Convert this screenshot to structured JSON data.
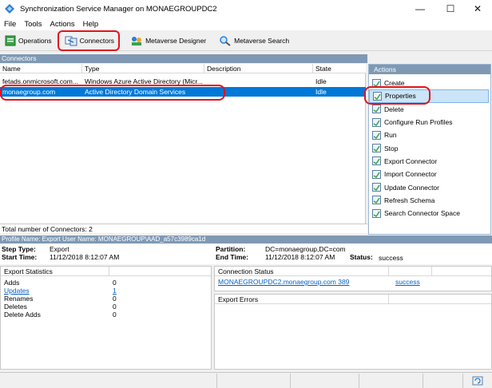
{
  "window": {
    "title": "Synchronization Service Manager on MONAEGROUPDC2",
    "minimize": "—",
    "maximize": "☐",
    "close": "✕"
  },
  "menu": [
    "File",
    "Tools",
    "Actions",
    "Help"
  ],
  "toolbar": {
    "operations": "Operations",
    "connectors": "Connectors",
    "metaverse_designer": "Metaverse Designer",
    "metaverse_search": "Metaverse Search"
  },
  "connectors": {
    "section_title": "Connectors",
    "columns": [
      "Name",
      "Type",
      "Description",
      "State"
    ],
    "rows": [
      {
        "name": "fetads.onmicrosoft.com...",
        "type": "Windows Azure Active Directory (Micr...",
        "description": "",
        "state": "Idle"
      },
      {
        "name": "monaegroup.com",
        "type": "Active Directory Domain Services",
        "description": "",
        "state": "Idle"
      }
    ],
    "count_text": "Total number of Connectors: 2"
  },
  "actions": {
    "title": "Actions",
    "items": [
      "Create",
      "Properties",
      "Delete",
      "Configure Run Profiles",
      "Run",
      "Stop",
      "Export Connector",
      "Import Connector",
      "Update Connector",
      "Refresh Schema",
      "Search Connector Space"
    ]
  },
  "profile": {
    "bar_text": "Profile Name: Export  User Name: MONAEGROUP\\AAD_a57c3989ca1d",
    "step_type_label": "Step Type:",
    "step_type": "Export",
    "start_time_label": "Start Time:",
    "start_time": "11/12/2018 8:12:07 AM",
    "partition_label": "Partition:",
    "partition": "DC=monaegroup,DC=com",
    "end_time_label": "End Time:",
    "end_time": "11/12/2018 8:12:07 AM",
    "status_label": "Status:",
    "status": "success"
  },
  "export_statistics": {
    "title": "Export Statistics",
    "rows": [
      {
        "label": "Adds",
        "value": "0"
      },
      {
        "label": "Updates",
        "value": "1"
      },
      {
        "label": "Renames",
        "value": "0"
      },
      {
        "label": "Deletes",
        "value": "0"
      },
      {
        "label": "Delete Adds",
        "value": "0"
      }
    ]
  },
  "connection_status": {
    "title": "Connection Status",
    "server": "MONAEGROUPDC2.monaegroup.com 389",
    "result": "success"
  },
  "export_errors": {
    "title": "Export Errors"
  }
}
